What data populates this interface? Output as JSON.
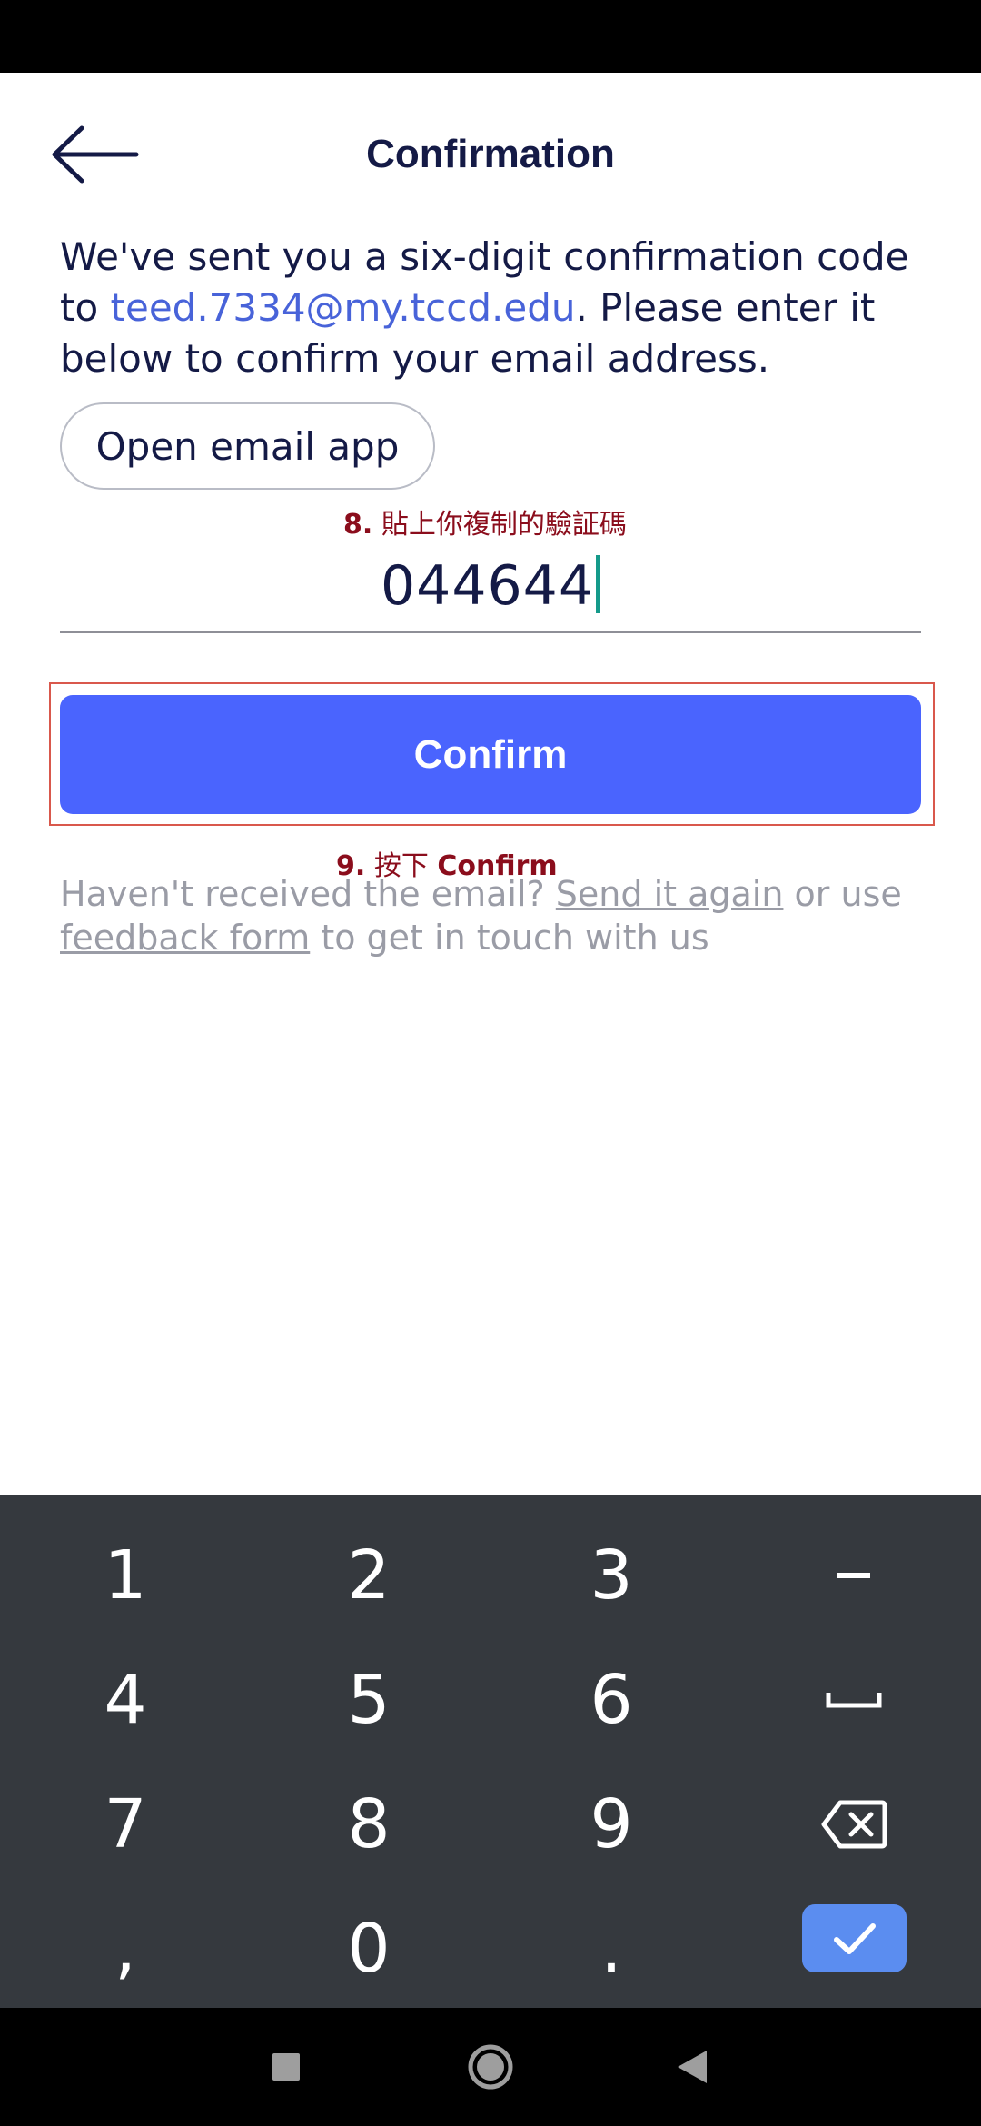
{
  "header": {
    "title": "Confirmation"
  },
  "message": {
    "before": "We've sent you a six-digit confirmation code to ",
    "email": "teed.7334@my.tccd.edu",
    "after": ". Please enter it below to confirm your email address."
  },
  "open_email_label": "Open email app",
  "annotations": {
    "step8_num": "8.",
    "step8_text": "貼上你複制的驗証碼",
    "step9_num": "9.",
    "step9_text": "按下",
    "step9_bold": "Confirm"
  },
  "code_input": {
    "value": "044644"
  },
  "confirm_label": "Confirm",
  "help": {
    "prefix": "Haven't received the email? ",
    "send_again": "Send it again",
    "middle": " or use ",
    "feedback": "feedback form",
    "suffix": " to get in touch with us"
  },
  "keyboard": {
    "keys": [
      "1",
      "2",
      "3",
      "4",
      "5",
      "6",
      "7",
      "8",
      "9",
      ",",
      "0",
      "."
    ],
    "icons": [
      "minus-icon",
      "space-icon",
      "backspace-icon",
      "checkmark-icon"
    ]
  },
  "nav": {
    "icons": [
      "recent-apps-icon",
      "home-icon",
      "back-icon"
    ]
  }
}
